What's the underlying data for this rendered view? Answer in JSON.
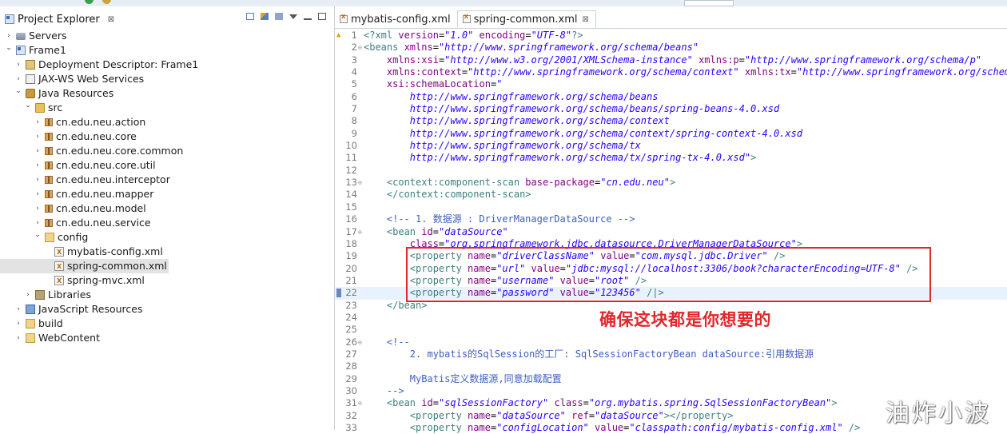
{
  "explorer": {
    "title": "Project Explorer",
    "close_glyph": "⊠",
    "tree": [
      {
        "label": "Servers",
        "depth": 0,
        "expanded": false,
        "icon": "servers-icon"
      },
      {
        "label": "Frame1",
        "depth": 0,
        "expanded": true,
        "icon": "project-icon"
      },
      {
        "label": "Deployment Descriptor: Frame1",
        "depth": 1,
        "expanded": false,
        "icon": "deployment-descriptor-icon"
      },
      {
        "label": "JAX-WS Web Services",
        "depth": 1,
        "expanded": false,
        "icon": "web-services-icon"
      },
      {
        "label": "Java Resources",
        "depth": 1,
        "expanded": true,
        "icon": "java-resources-icon"
      },
      {
        "label": "src",
        "depth": 2,
        "expanded": true,
        "icon": "source-folder-icon"
      },
      {
        "label": "cn.edu.neu.action",
        "depth": 3,
        "expanded": false,
        "icon": "package-icon"
      },
      {
        "label": "cn.edu.neu.core",
        "depth": 3,
        "expanded": false,
        "icon": "package-icon"
      },
      {
        "label": "cn.edu.neu.core.common",
        "depth": 3,
        "expanded": false,
        "icon": "package-icon"
      },
      {
        "label": "cn.edu.neu.core.util",
        "depth": 3,
        "expanded": false,
        "icon": "package-icon"
      },
      {
        "label": "cn.edu.neu.interceptor",
        "depth": 3,
        "expanded": false,
        "icon": "package-icon"
      },
      {
        "label": "cn.edu.neu.mapper",
        "depth": 3,
        "expanded": false,
        "icon": "package-icon"
      },
      {
        "label": "cn.edu.neu.model",
        "depth": 3,
        "expanded": false,
        "icon": "package-icon"
      },
      {
        "label": "cn.edu.neu.service",
        "depth": 3,
        "expanded": false,
        "icon": "package-icon"
      },
      {
        "label": "config",
        "depth": 3,
        "expanded": true,
        "icon": "folder-icon"
      },
      {
        "label": "mybatis-config.xml",
        "depth": 4,
        "leaf": true,
        "icon": "xml-file-icon"
      },
      {
        "label": "spring-common.xml",
        "depth": 4,
        "leaf": true,
        "selected": true,
        "icon": "xml-file-icon"
      },
      {
        "label": "spring-mvc.xml",
        "depth": 4,
        "leaf": true,
        "icon": "xml-file-icon"
      },
      {
        "label": "Libraries",
        "depth": 2,
        "expanded": false,
        "icon": "libraries-icon"
      },
      {
        "label": "JavaScript Resources",
        "depth": 1,
        "expanded": false,
        "icon": "javascript-resources-icon"
      },
      {
        "label": "build",
        "depth": 1,
        "expanded": false,
        "icon": "folder-icon"
      },
      {
        "label": "WebContent",
        "depth": 1,
        "expanded": false,
        "icon": "folder-icon"
      }
    ]
  },
  "editor": {
    "tabs": [
      {
        "label": "mybatis-config.xml",
        "active": false
      },
      {
        "label": "spring-common.xml",
        "active": true,
        "close_glyph": "⊠"
      }
    ],
    "lines": [
      {
        "n": "1",
        "mark": "warn",
        "fold": "",
        "segs": [
          [
            "pi",
            "<?xml "
          ],
          [
            "attr",
            "version"
          ],
          [
            "text",
            "="
          ],
          [
            "val",
            "\"1.0\""
          ],
          [
            "text",
            " "
          ],
          [
            "attr",
            "encoding"
          ],
          [
            "text",
            "="
          ],
          [
            "val",
            "\"UTF-8\""
          ],
          [
            "pi",
            "?>"
          ]
        ]
      },
      {
        "n": "2",
        "fold": "⊖",
        "segs": [
          [
            "tag",
            "<beans "
          ],
          [
            "attr",
            "xmlns"
          ],
          [
            "text",
            "="
          ],
          [
            "val",
            "\"http://www.springframework.org/schema/beans\""
          ]
        ]
      },
      {
        "n": "3",
        "segs": [
          [
            "text",
            "    "
          ],
          [
            "attr",
            "xmlns:xsi"
          ],
          [
            "text",
            "="
          ],
          [
            "val",
            "\"http://www.w3.org/2001/XMLSchema-instance\""
          ],
          [
            "text",
            " "
          ],
          [
            "attr",
            "xmlns:p"
          ],
          [
            "text",
            "="
          ],
          [
            "val",
            "\"http://www.springframework.org/schema/p\""
          ]
        ]
      },
      {
        "n": "4",
        "segs": [
          [
            "text",
            "    "
          ],
          [
            "attr",
            "xmlns:context"
          ],
          [
            "text",
            "="
          ],
          [
            "val",
            "\"http://www.springframework.org/schema/context\""
          ],
          [
            "text",
            " "
          ],
          [
            "attr",
            "xmlns:tx"
          ],
          [
            "text",
            "="
          ],
          [
            "val",
            "\"http://www.springframework.org/schema/tx\""
          ]
        ]
      },
      {
        "n": "5",
        "segs": [
          [
            "text",
            "    "
          ],
          [
            "attr",
            "xsi:schemaLocation"
          ],
          [
            "text",
            "="
          ],
          [
            "val",
            "\""
          ]
        ]
      },
      {
        "n": "6",
        "segs": [
          [
            "text",
            "        "
          ],
          [
            "val",
            "http://www.springframework.org/schema/beans"
          ]
        ]
      },
      {
        "n": "7",
        "segs": [
          [
            "text",
            "        "
          ],
          [
            "val",
            "http://www.springframework.org/schema/beans/spring-beans-4.0.xsd"
          ]
        ]
      },
      {
        "n": "8",
        "segs": [
          [
            "text",
            "        "
          ],
          [
            "val",
            "http://www.springframework.org/schema/context"
          ]
        ]
      },
      {
        "n": "9",
        "segs": [
          [
            "text",
            "        "
          ],
          [
            "val",
            "http://www.springframework.org/schema/context/spring-context-4.0.xsd"
          ]
        ]
      },
      {
        "n": "10",
        "segs": [
          [
            "text",
            "        "
          ],
          [
            "val",
            "http://www.springframework.org/schema/tx"
          ]
        ]
      },
      {
        "n": "11",
        "segs": [
          [
            "text",
            "        "
          ],
          [
            "val",
            "http://www.springframework.org/schema/tx/spring-tx-4.0.xsd\""
          ],
          [
            "tag",
            ">"
          ]
        ]
      },
      {
        "n": "12",
        "segs": []
      },
      {
        "n": "13",
        "fold": "⊖",
        "segs": [
          [
            "text",
            "    "
          ],
          [
            "tag",
            "<context:component-scan "
          ],
          [
            "attr",
            "base-package"
          ],
          [
            "text",
            "="
          ],
          [
            "val",
            "\"cn.edu.neu\""
          ],
          [
            "tag",
            ">"
          ]
        ]
      },
      {
        "n": "14",
        "segs": [
          [
            "text",
            "    "
          ],
          [
            "tag",
            "</context:component-scan>"
          ]
        ]
      },
      {
        "n": "15",
        "segs": []
      },
      {
        "n": "16",
        "segs": [
          [
            "text",
            "    "
          ],
          [
            "cmt",
            "<!-- 1. 数据源 : DriverManagerDataSource -->"
          ]
        ]
      },
      {
        "n": "17",
        "fold": "⊖",
        "segs": [
          [
            "text",
            "    "
          ],
          [
            "tag",
            "<bean "
          ],
          [
            "attr",
            "id"
          ],
          [
            "text",
            "="
          ],
          [
            "val",
            "\"dataSource\""
          ]
        ]
      },
      {
        "n": "18",
        "segs": [
          [
            "text",
            "        "
          ],
          [
            "attr",
            "class"
          ],
          [
            "text",
            "="
          ],
          [
            "val",
            "\"org.springframework.jdbc.datasource.DriverManagerDataSource\""
          ],
          [
            "tag",
            ">"
          ]
        ]
      },
      {
        "n": "19",
        "segs": [
          [
            "text",
            "        "
          ],
          [
            "tag",
            "<property "
          ],
          [
            "attr",
            "name"
          ],
          [
            "text",
            "="
          ],
          [
            "val",
            "\"driverClassName\""
          ],
          [
            "text",
            " "
          ],
          [
            "attr",
            "value"
          ],
          [
            "text",
            "="
          ],
          [
            "val",
            "\"com.mysql.jdbc.Driver\""
          ],
          [
            "text",
            " "
          ],
          [
            "tag",
            "/>"
          ]
        ]
      },
      {
        "n": "20",
        "segs": [
          [
            "text",
            "        "
          ],
          [
            "tag",
            "<property "
          ],
          [
            "attr",
            "name"
          ],
          [
            "text",
            "="
          ],
          [
            "val",
            "\"url\""
          ],
          [
            "text",
            " "
          ],
          [
            "attr",
            "value"
          ],
          [
            "text",
            "="
          ],
          [
            "val",
            "\"jdbc:mysql://localhost:3306/book?characterEncoding=UTF-8\""
          ],
          [
            "text",
            " "
          ],
          [
            "tag",
            "/>"
          ]
        ]
      },
      {
        "n": "21",
        "segs": [
          [
            "text",
            "        "
          ],
          [
            "tag",
            "<property "
          ],
          [
            "attr",
            "name"
          ],
          [
            "text",
            "="
          ],
          [
            "val",
            "\"username\""
          ],
          [
            "text",
            " "
          ],
          [
            "attr",
            "value"
          ],
          [
            "text",
            "="
          ],
          [
            "val",
            "\"root\""
          ],
          [
            "text",
            " "
          ],
          [
            "tag",
            "/>"
          ]
        ]
      },
      {
        "n": "22",
        "mark": "cursor",
        "current": true,
        "segs": [
          [
            "text",
            "        "
          ],
          [
            "tag",
            "<property "
          ],
          [
            "attr",
            "name"
          ],
          [
            "text",
            "="
          ],
          [
            "val",
            "\"password\""
          ],
          [
            "text",
            " "
          ],
          [
            "attr",
            "value"
          ],
          [
            "text",
            "="
          ],
          [
            "val",
            "\"123456\""
          ],
          [
            "text",
            " "
          ],
          [
            "tag",
            "/|>"
          ]
        ]
      },
      {
        "n": "23",
        "segs": [
          [
            "text",
            "    "
          ],
          [
            "tag",
            "</bean>"
          ]
        ]
      },
      {
        "n": "24",
        "segs": []
      },
      {
        "n": "25",
        "segs": []
      },
      {
        "n": "26",
        "fold": "⊖",
        "segs": [
          [
            "text",
            "    "
          ],
          [
            "cmt",
            "<!--"
          ]
        ]
      },
      {
        "n": "27",
        "segs": [
          [
            "text",
            "        "
          ],
          [
            "cmt",
            "2. mybatis的SqlSession的工厂: SqlSessionFactoryBean dataSource:引用数据源"
          ]
        ]
      },
      {
        "n": "28",
        "segs": []
      },
      {
        "n": "29",
        "segs": [
          [
            "text",
            "        "
          ],
          [
            "cmt",
            "MyBatis定义数据源,同意加载配置"
          ]
        ]
      },
      {
        "n": "30",
        "segs": [
          [
            "text",
            "    "
          ],
          [
            "cmt",
            "-->"
          ]
        ]
      },
      {
        "n": "31",
        "fold": "⊖",
        "segs": [
          [
            "text",
            "    "
          ],
          [
            "tag",
            "<bean "
          ],
          [
            "attr",
            "id"
          ],
          [
            "text",
            "="
          ],
          [
            "val",
            "\"sqlSessionFactory\""
          ],
          [
            "text",
            " "
          ],
          [
            "attr",
            "class"
          ],
          [
            "text",
            "="
          ],
          [
            "val",
            "\"org.mybatis.spring.SqlSessionFactoryBean\""
          ],
          [
            "tag",
            ">"
          ]
        ]
      },
      {
        "n": "32",
        "segs": [
          [
            "text",
            "        "
          ],
          [
            "tag",
            "<property "
          ],
          [
            "attr",
            "name"
          ],
          [
            "text",
            "="
          ],
          [
            "val",
            "\"dataSource\""
          ],
          [
            "text",
            " "
          ],
          [
            "attr",
            "ref"
          ],
          [
            "text",
            "="
          ],
          [
            "val",
            "\"dataSource\""
          ],
          [
            "tag",
            "></property>"
          ]
        ]
      },
      {
        "n": "33",
        "segs": [
          [
            "text",
            "        "
          ],
          [
            "tag",
            "<property "
          ],
          [
            "attr",
            "name"
          ],
          [
            "text",
            "="
          ],
          [
            "val",
            "\"configLocation\""
          ],
          [
            "text",
            " "
          ],
          [
            "attr",
            "value"
          ],
          [
            "text",
            "="
          ],
          [
            "val",
            "\"classpath:config/mybatis-config.xml\""
          ],
          [
            "text",
            " "
          ],
          [
            "tag",
            "/>"
          ]
        ]
      }
    ]
  },
  "annotation": {
    "note": "确保这块都是你想要的",
    "watermark": "油炸小波",
    "color": "#e0282d"
  }
}
